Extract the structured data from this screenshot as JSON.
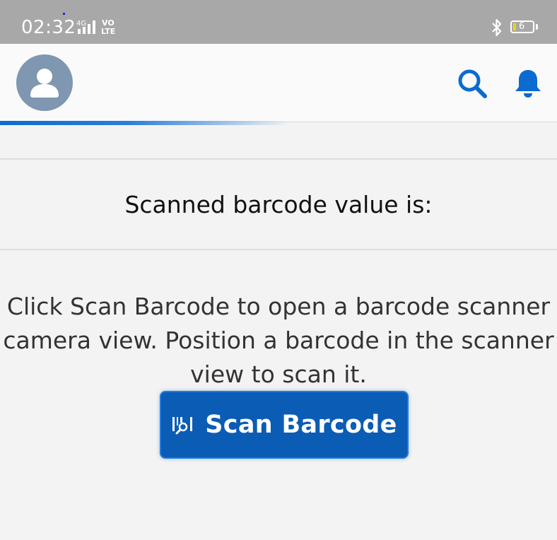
{
  "status_bar": {
    "time": "02:32",
    "network_label": "4G",
    "volte_label": "VO LTE",
    "battery_level": "6",
    "icons": [
      "signal-icon",
      "bluetooth-icon",
      "battery-icon"
    ]
  },
  "header": {
    "avatar_icon": "user-avatar-icon",
    "search_icon": "search-icon",
    "notifications_icon": "bell-icon",
    "accent_color": "#0b6bd0"
  },
  "main": {
    "scanned_label": "Scanned barcode value is:",
    "instructions": "Click Scan Barcode to open a barcode scanner camera view. Position a barcode in the scanner view to scan it.",
    "scan_button": {
      "label": "Scan Barcode",
      "icon": "barcode-scan-icon",
      "color": "#0b5cb5"
    }
  }
}
